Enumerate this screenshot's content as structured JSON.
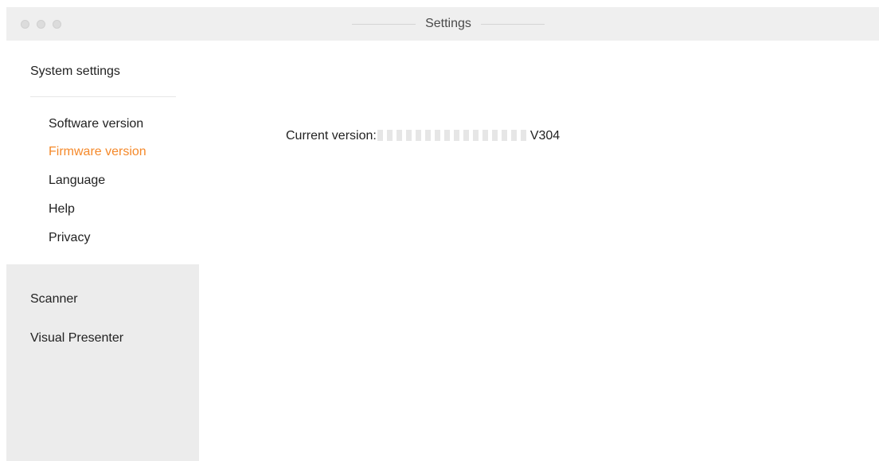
{
  "window": {
    "title": "Settings"
  },
  "sidebar": {
    "system_settings": {
      "label": "System settings",
      "items": [
        {
          "label": "Software version",
          "active": false
        },
        {
          "label": "Firmware version",
          "active": true
        },
        {
          "label": "Language",
          "active": false
        },
        {
          "label": "Help",
          "active": false
        },
        {
          "label": "Privacy",
          "active": false
        }
      ]
    },
    "scanner": {
      "label": "Scanner"
    },
    "visual_presenter": {
      "label": "Visual Presenter"
    }
  },
  "main": {
    "version_label": "Current version:",
    "version_suffix": "V304"
  },
  "colors": {
    "accent": "#f5892a",
    "titlebar_bg": "#efefef",
    "sidebar_bottom_bg": "#ececec"
  }
}
